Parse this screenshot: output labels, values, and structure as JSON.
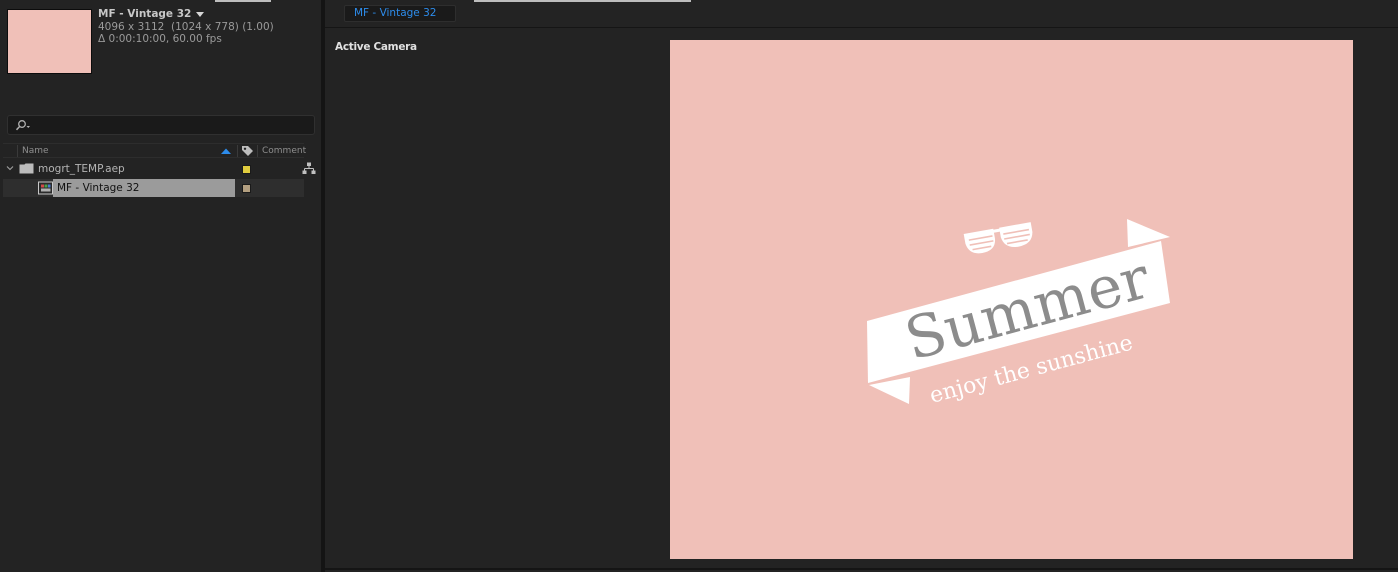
{
  "project_panel": {
    "selected_item": {
      "name": "MF - Vintage 32",
      "dimensions": "4096 x 3112  (1024 x 778) (1.00)",
      "duration": "Δ 0:00:10:00, 60.00 fps",
      "thumbnail_color": "#f0c0b8"
    },
    "search": {
      "value": "",
      "placeholder": "",
      "icon": "search-icon"
    },
    "columns": {
      "name": "Name",
      "comment": "Comment"
    },
    "items": [
      {
        "name": "mogrt_TEMP.aep",
        "type": "folder",
        "label_color": "#e0cc3e",
        "expanded": true
      },
      {
        "name": "MF - Vintage 32",
        "type": "composition",
        "label_color": "#b39f80",
        "selected": true
      }
    ]
  },
  "composition_panel": {
    "tab_label": "MF - Vintage 32",
    "view_label": "Active Camera",
    "canvas": {
      "background": "#f0c0b8",
      "headline": "Summer",
      "tagline": "enjoy the sunshine"
    }
  },
  "colors": {
    "accent_blue": "#2d8ceb",
    "panel_bg": "#232323"
  }
}
